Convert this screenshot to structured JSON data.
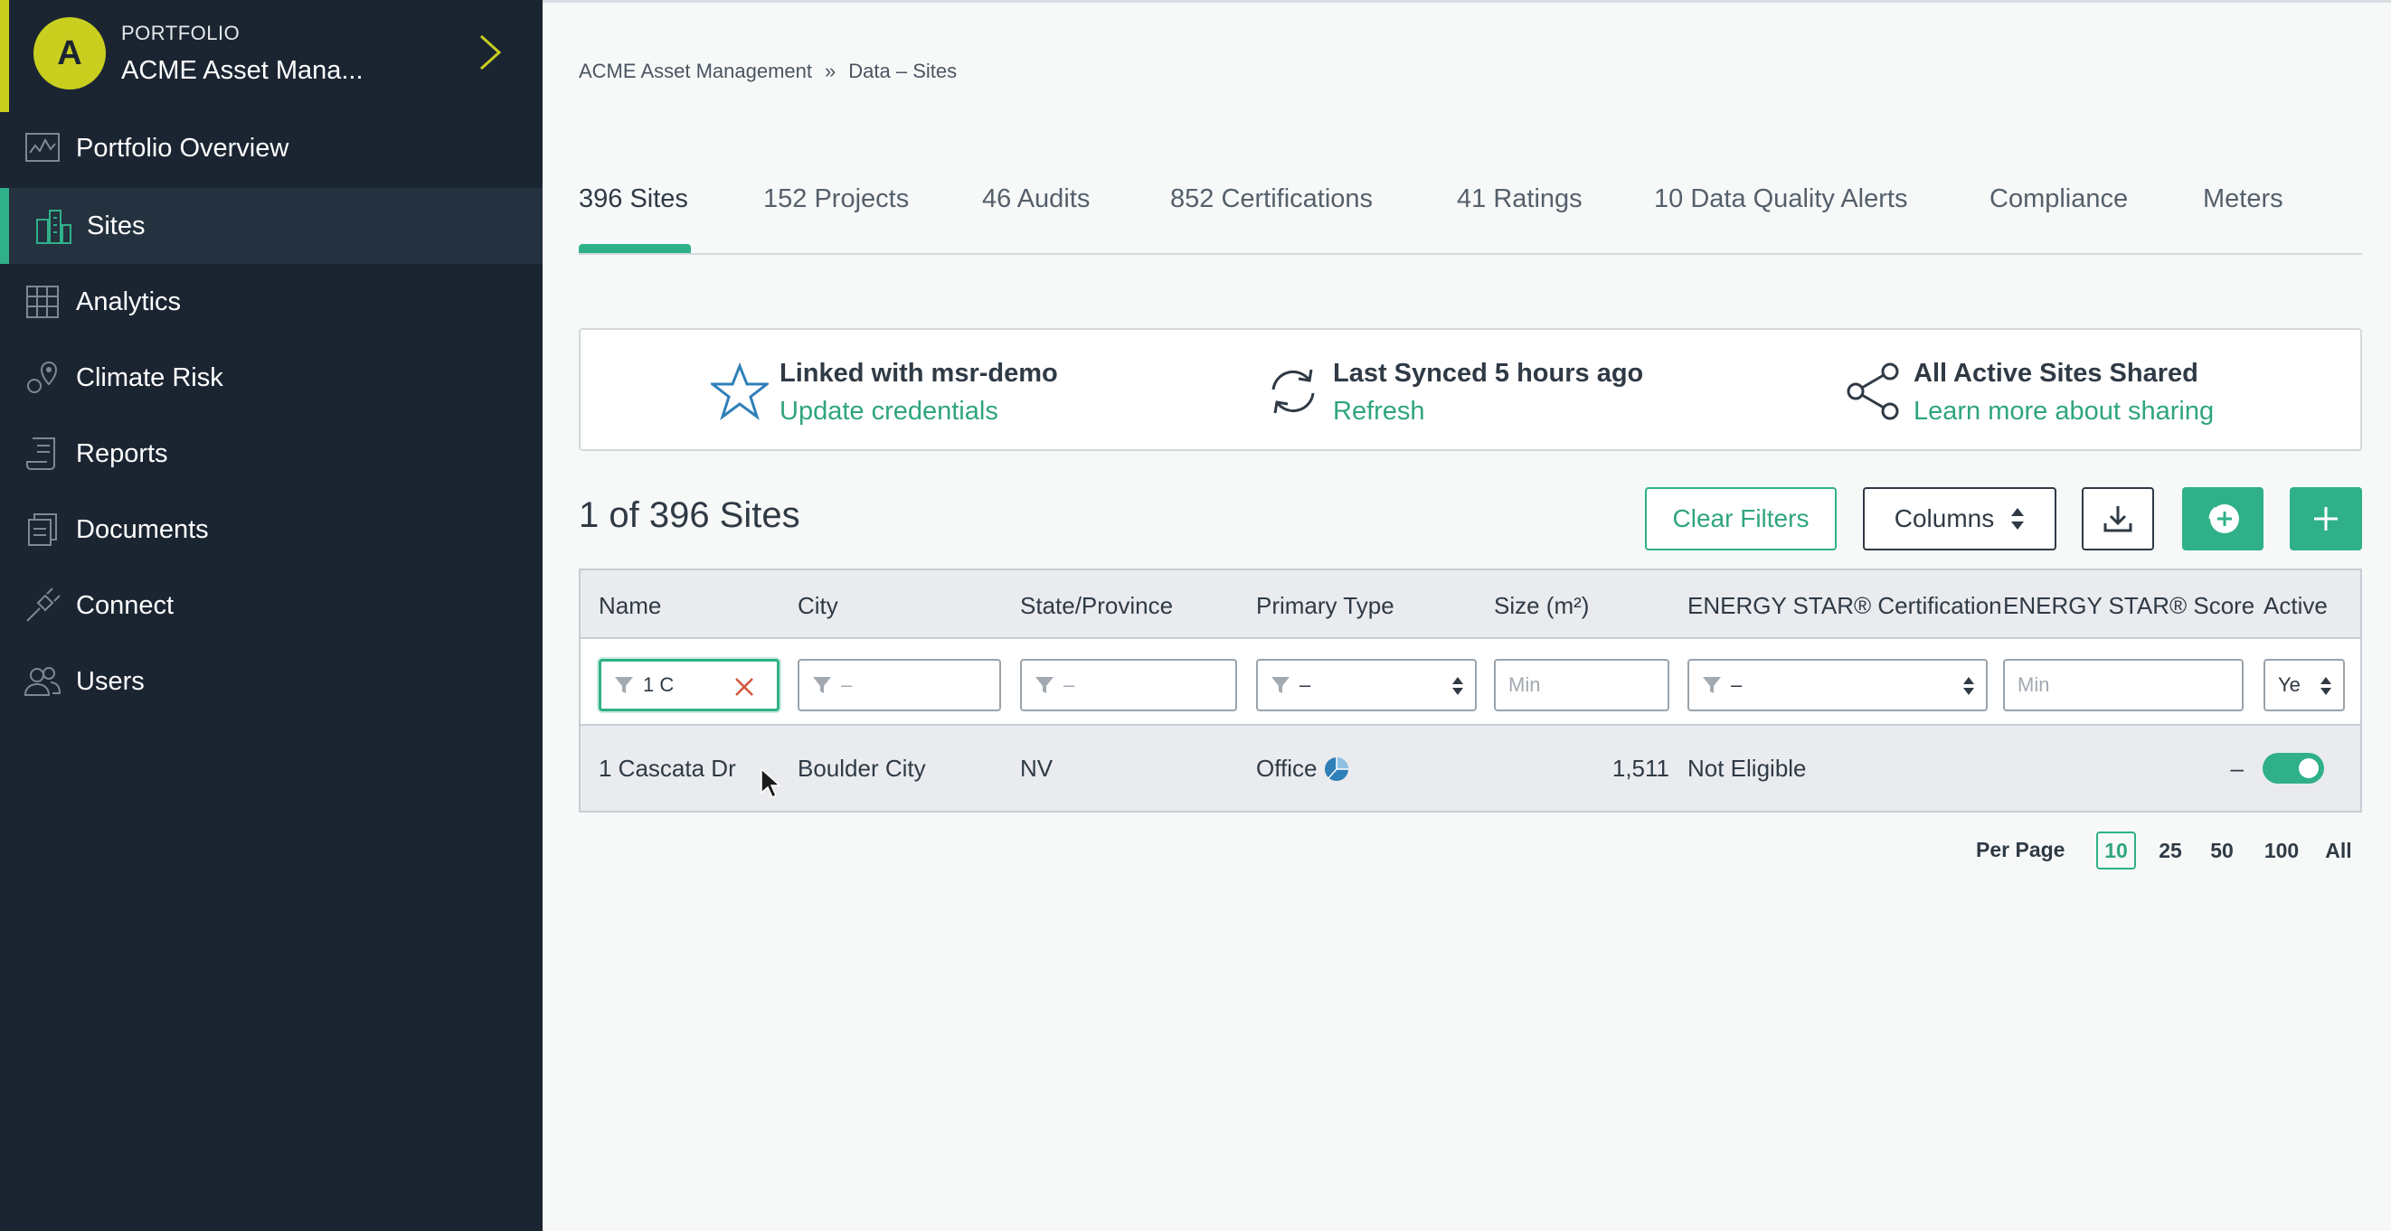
{
  "portfolio": {
    "avatar_letter": "A",
    "label": "PORTFOLIO",
    "name": "ACME Asset Mana..."
  },
  "nav": {
    "items": [
      {
        "label": "Portfolio Overview",
        "icon": "chart-monitor-icon"
      },
      {
        "label": "Sites",
        "icon": "buildings-icon",
        "active": true
      },
      {
        "label": "Analytics",
        "icon": "bar-chart-icon"
      },
      {
        "label": "Climate Risk",
        "icon": "map-pin-icon"
      },
      {
        "label": "Reports",
        "icon": "scroll-icon"
      },
      {
        "label": "Documents",
        "icon": "documents-icon"
      },
      {
        "label": "Connect",
        "icon": "plug-icon"
      },
      {
        "label": "Users",
        "icon": "users-icon"
      }
    ]
  },
  "breadcrumb": {
    "root": "ACME Asset Management",
    "separator": "»",
    "current": "Data – Sites"
  },
  "tabs": [
    {
      "label": "396 Sites",
      "active": true
    },
    {
      "label": "152 Projects"
    },
    {
      "label": "46 Audits"
    },
    {
      "label": "852 Certifications"
    },
    {
      "label": "41 Ratings"
    },
    {
      "label": "10 Data Quality Alerts"
    },
    {
      "label": "Compliance"
    },
    {
      "label": "Meters"
    }
  ],
  "info": {
    "linked": {
      "title": "Linked with msr-demo",
      "link": "Update credentials"
    },
    "synced": {
      "title": "Last Synced 5 hours ago",
      "link": "Refresh"
    },
    "shared": {
      "title": "All Active Sites Shared",
      "link": "Learn more about sharing"
    }
  },
  "sites_count": "1 of 396 Sites",
  "toolbar": {
    "clear_filters": "Clear Filters",
    "columns": "Columns"
  },
  "table": {
    "headers": [
      "Name",
      "City",
      "State/Province",
      "Primary Type",
      "Size (m²)",
      "ENERGY STAR® Certification",
      "ENERGY STAR® Score",
      "Active"
    ],
    "filters": {
      "name_value": "1 C",
      "city_placeholder": "–",
      "state_placeholder": "–",
      "type_value": "–",
      "size_placeholder": "Min",
      "cert_value": "–",
      "score_placeholder": "Min",
      "active_value": "Ye"
    },
    "rows": [
      {
        "name": "1 Cascata Dr",
        "city": "Boulder City",
        "state": "NV",
        "type": "Office",
        "size": "1,511",
        "certification": "Not Eligible",
        "score": "–",
        "active": true
      }
    ]
  },
  "pager": {
    "label": "Per Page",
    "options": [
      "10",
      "25",
      "50",
      "100",
      "All"
    ],
    "selected": "10"
  },
  "colors": {
    "accent": "#2fb089",
    "sidebar": "#1b2532",
    "avatar": "#c9ce1f"
  }
}
